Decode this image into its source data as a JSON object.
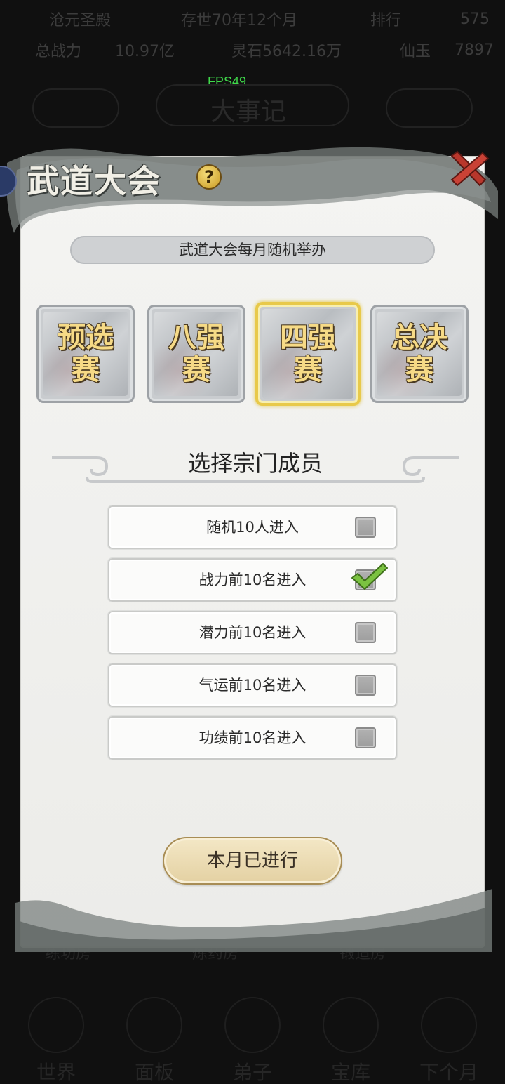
{
  "background": {
    "top_row_1": [
      "沧元圣殿",
      "存世70年12个月",
      "排行",
      "575"
    ],
    "top_row_2": [
      "总战力",
      "10.97亿",
      "灵石5642.16万",
      "仙玉",
      "7897"
    ],
    "fps": "FPS49",
    "screen_title": "大事记",
    "bottom_labels": [
      "练功房",
      "炼药房",
      "锻造房"
    ],
    "nav": [
      "世界",
      "面板",
      "弟子",
      "宝库",
      "下个月"
    ]
  },
  "modal": {
    "title": "武道大会",
    "help_symbol": "?",
    "subtitle": "武道大会每月随机举办",
    "stages": [
      {
        "line1": "预选",
        "line2": "赛",
        "active": false
      },
      {
        "line1": "八强",
        "line2": "赛",
        "active": false
      },
      {
        "line1": "四强",
        "line2": "赛",
        "active": true
      },
      {
        "line1": "总决",
        "line2": "赛",
        "active": false
      }
    ],
    "section_title": "选择宗门成员",
    "options": [
      {
        "label": "随机10人进入",
        "checked": false
      },
      {
        "label": "战力前10名进入",
        "checked": true
      },
      {
        "label": "潜力前10名进入",
        "checked": false
      },
      {
        "label": "气运前10名进入",
        "checked": false
      },
      {
        "label": "功绩前10名进入",
        "checked": false
      }
    ],
    "action_button": "本月已进行"
  },
  "colors": {
    "accent_gold": "#e8c94a",
    "check_green": "#7bc241",
    "close_red": "#c0392b"
  }
}
